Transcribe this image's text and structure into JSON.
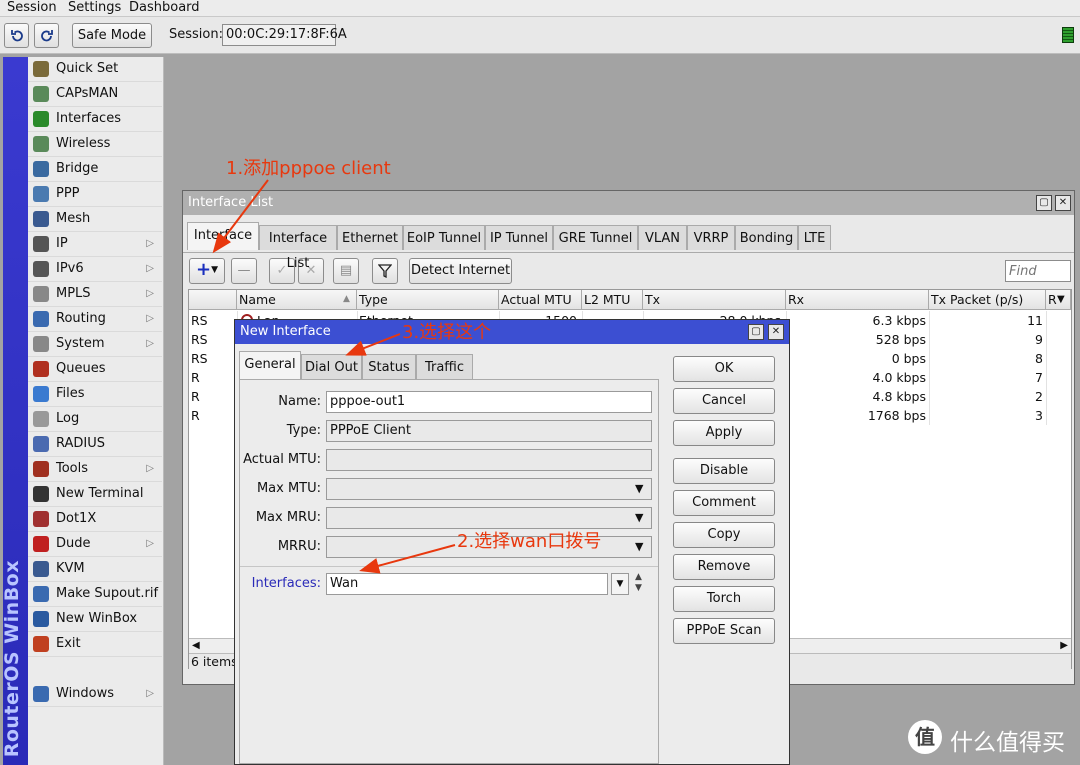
{
  "menu": [
    "Session",
    "Settings",
    "Dashboard"
  ],
  "toolbar": {
    "safe_mode": "Safe Mode",
    "session_label": "Session:",
    "session_value": "00:0C:29:17:8F:6A"
  },
  "brand": "RouterOS WinBox",
  "sidebar": [
    {
      "label": "Quick Set",
      "icon": "wand-icon",
      "color": "#7a6a3a",
      "sub": false
    },
    {
      "label": "CAPsMAN",
      "icon": "capsman-icon",
      "color": "#5a8a5a",
      "sub": false
    },
    {
      "label": "Interfaces",
      "icon": "interfaces-icon",
      "color": "#2a8a2a",
      "sub": false
    },
    {
      "label": "Wireless",
      "icon": "wireless-icon",
      "color": "#5a8a5a",
      "sub": false
    },
    {
      "label": "Bridge",
      "icon": "bridge-icon",
      "color": "#3a6aa0",
      "sub": false
    },
    {
      "label": "PPP",
      "icon": "ppp-icon",
      "color": "#4a7ab0",
      "sub": false
    },
    {
      "label": "Mesh",
      "icon": "mesh-icon",
      "color": "#3a5a90",
      "sub": false
    },
    {
      "label": "IP",
      "icon": "ip-icon",
      "color": "#555555",
      "sub": true
    },
    {
      "label": "IPv6",
      "icon": "ipv6-icon",
      "color": "#555555",
      "sub": true
    },
    {
      "label": "MPLS",
      "icon": "mpls-icon",
      "color": "#888888",
      "sub": true
    },
    {
      "label": "Routing",
      "icon": "routing-icon",
      "color": "#3a6ab0",
      "sub": true
    },
    {
      "label": "System",
      "icon": "system-icon",
      "color": "#888888",
      "sub": true
    },
    {
      "label": "Queues",
      "icon": "queues-icon",
      "color": "#b03020",
      "sub": false
    },
    {
      "label": "Files",
      "icon": "files-icon",
      "color": "#3a7ad0",
      "sub": false
    },
    {
      "label": "Log",
      "icon": "log-icon",
      "color": "#999999",
      "sub": false
    },
    {
      "label": "RADIUS",
      "icon": "radius-icon",
      "color": "#4a6ab0",
      "sub": false
    },
    {
      "label": "Tools",
      "icon": "tools-icon",
      "color": "#a03020",
      "sub": true
    },
    {
      "label": "New Terminal",
      "icon": "terminal-icon",
      "color": "#333333",
      "sub": false
    },
    {
      "label": "Dot1X",
      "icon": "dot1x-icon",
      "color": "#a03030",
      "sub": false
    },
    {
      "label": "Dude",
      "icon": "dude-icon",
      "color": "#c02020",
      "sub": true
    },
    {
      "label": "KVM",
      "icon": "kvm-icon",
      "color": "#3a5a90",
      "sub": false
    },
    {
      "label": "Make Supout.rif",
      "icon": "supout-icon",
      "color": "#3a6ab0",
      "sub": false
    },
    {
      "label": "New WinBox",
      "icon": "winbox-icon",
      "color": "#2a5aa0",
      "sub": false
    },
    {
      "label": "Exit",
      "icon": "exit-icon",
      "color": "#c04020",
      "sub": false
    },
    {
      "label": "Windows",
      "icon": "windows-icon",
      "color": "#3a6ab0",
      "sub": true
    }
  ],
  "interface_list": {
    "title": "Interface List",
    "tabs": [
      "Interface",
      "Interface List",
      "Ethernet",
      "EoIP Tunnel",
      "IP Tunnel",
      "GRE Tunnel",
      "VLAN",
      "VRRP",
      "Bonding",
      "LTE"
    ],
    "detect_internet": "Detect Internet",
    "find_placeholder": "Find",
    "columns": [
      "",
      "Name",
      "Type",
      "Actual MTU",
      "L2 MTU",
      "Tx",
      "Rx",
      "Tx Packet (p/s)",
      "R"
    ],
    "row1": {
      "flag": "RS",
      "name": "Lan",
      "type": "Ethernet",
      "mtu": "1500",
      "tx": "28.0 kbps",
      "rx": "6.3 kbps",
      "txp": "11"
    },
    "rows": [
      {
        "flag": "RS",
        "rx": "528 bps",
        "txp": "9"
      },
      {
        "flag": "RS",
        "rx": "0 bps",
        "txp": "8"
      },
      {
        "flag": "R",
        "rx": "4.0 kbps",
        "txp": "7"
      },
      {
        "flag": "R",
        "rx": "4.8 kbps",
        "txp": "2"
      },
      {
        "flag": "R",
        "rx": "1768 bps",
        "txp": "3"
      }
    ],
    "status": "6 items"
  },
  "new_interface": {
    "title": "New Interface",
    "tabs": [
      "General",
      "Dial Out",
      "Status",
      "Traffic"
    ],
    "labels": {
      "name": "Name:",
      "type": "Type:",
      "actual_mtu": "Actual MTU:",
      "max_mtu": "Max MTU:",
      "max_mru": "Max MRU:",
      "mrru": "MRRU:",
      "interfaces": "Interfaces:"
    },
    "values": {
      "name": "pppoe-out1",
      "type": "PPPoE Client",
      "actual_mtu": "",
      "max_mtu": "",
      "max_mru": "",
      "mrru": "",
      "interfaces": "Wan"
    },
    "buttons": [
      "OK",
      "Cancel",
      "Apply",
      "Disable",
      "Comment",
      "Copy",
      "Remove",
      "Torch",
      "PPPoE Scan"
    ]
  },
  "annotations": {
    "a1": "1.添加pppoe client",
    "a2": "2.选择wan口拨号",
    "a3": "3.选择这个"
  },
  "colors": {
    "titlebar_inactive": "#b0b0b0",
    "titlebar_active": "#3c4fd2",
    "annotation": "#e8380e",
    "brand_bar": "#3232c8"
  },
  "watermark": {
    "logo": "值",
    "text": "什么值得买"
  }
}
